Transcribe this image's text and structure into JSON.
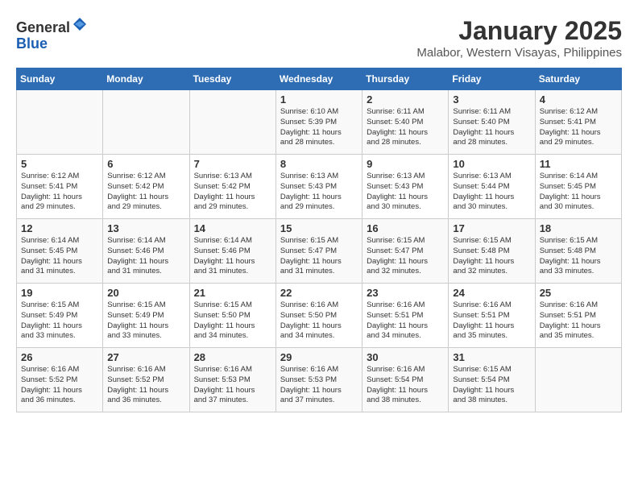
{
  "header": {
    "logo_line1": "General",
    "logo_line2": "Blue",
    "title": "January 2025",
    "subtitle": "Malabor, Western Visayas, Philippines"
  },
  "days_of_week": [
    "Sunday",
    "Monday",
    "Tuesday",
    "Wednesday",
    "Thursday",
    "Friday",
    "Saturday"
  ],
  "weeks": [
    [
      {
        "day": "",
        "info": ""
      },
      {
        "day": "",
        "info": ""
      },
      {
        "day": "",
        "info": ""
      },
      {
        "day": "1",
        "info": "Sunrise: 6:10 AM\nSunset: 5:39 PM\nDaylight: 11 hours\nand 28 minutes."
      },
      {
        "day": "2",
        "info": "Sunrise: 6:11 AM\nSunset: 5:40 PM\nDaylight: 11 hours\nand 28 minutes."
      },
      {
        "day": "3",
        "info": "Sunrise: 6:11 AM\nSunset: 5:40 PM\nDaylight: 11 hours\nand 28 minutes."
      },
      {
        "day": "4",
        "info": "Sunrise: 6:12 AM\nSunset: 5:41 PM\nDaylight: 11 hours\nand 29 minutes."
      }
    ],
    [
      {
        "day": "5",
        "info": "Sunrise: 6:12 AM\nSunset: 5:41 PM\nDaylight: 11 hours\nand 29 minutes."
      },
      {
        "day": "6",
        "info": "Sunrise: 6:12 AM\nSunset: 5:42 PM\nDaylight: 11 hours\nand 29 minutes."
      },
      {
        "day": "7",
        "info": "Sunrise: 6:13 AM\nSunset: 5:42 PM\nDaylight: 11 hours\nand 29 minutes."
      },
      {
        "day": "8",
        "info": "Sunrise: 6:13 AM\nSunset: 5:43 PM\nDaylight: 11 hours\nand 29 minutes."
      },
      {
        "day": "9",
        "info": "Sunrise: 6:13 AM\nSunset: 5:43 PM\nDaylight: 11 hours\nand 30 minutes."
      },
      {
        "day": "10",
        "info": "Sunrise: 6:13 AM\nSunset: 5:44 PM\nDaylight: 11 hours\nand 30 minutes."
      },
      {
        "day": "11",
        "info": "Sunrise: 6:14 AM\nSunset: 5:45 PM\nDaylight: 11 hours\nand 30 minutes."
      }
    ],
    [
      {
        "day": "12",
        "info": "Sunrise: 6:14 AM\nSunset: 5:45 PM\nDaylight: 11 hours\nand 31 minutes."
      },
      {
        "day": "13",
        "info": "Sunrise: 6:14 AM\nSunset: 5:46 PM\nDaylight: 11 hours\nand 31 minutes."
      },
      {
        "day": "14",
        "info": "Sunrise: 6:14 AM\nSunset: 5:46 PM\nDaylight: 11 hours\nand 31 minutes."
      },
      {
        "day": "15",
        "info": "Sunrise: 6:15 AM\nSunset: 5:47 PM\nDaylight: 11 hours\nand 31 minutes."
      },
      {
        "day": "16",
        "info": "Sunrise: 6:15 AM\nSunset: 5:47 PM\nDaylight: 11 hours\nand 32 minutes."
      },
      {
        "day": "17",
        "info": "Sunrise: 6:15 AM\nSunset: 5:48 PM\nDaylight: 11 hours\nand 32 minutes."
      },
      {
        "day": "18",
        "info": "Sunrise: 6:15 AM\nSunset: 5:48 PM\nDaylight: 11 hours\nand 33 minutes."
      }
    ],
    [
      {
        "day": "19",
        "info": "Sunrise: 6:15 AM\nSunset: 5:49 PM\nDaylight: 11 hours\nand 33 minutes."
      },
      {
        "day": "20",
        "info": "Sunrise: 6:15 AM\nSunset: 5:49 PM\nDaylight: 11 hours\nand 33 minutes."
      },
      {
        "day": "21",
        "info": "Sunrise: 6:15 AM\nSunset: 5:50 PM\nDaylight: 11 hours\nand 34 minutes."
      },
      {
        "day": "22",
        "info": "Sunrise: 6:16 AM\nSunset: 5:50 PM\nDaylight: 11 hours\nand 34 minutes."
      },
      {
        "day": "23",
        "info": "Sunrise: 6:16 AM\nSunset: 5:51 PM\nDaylight: 11 hours\nand 34 minutes."
      },
      {
        "day": "24",
        "info": "Sunrise: 6:16 AM\nSunset: 5:51 PM\nDaylight: 11 hours\nand 35 minutes."
      },
      {
        "day": "25",
        "info": "Sunrise: 6:16 AM\nSunset: 5:51 PM\nDaylight: 11 hours\nand 35 minutes."
      }
    ],
    [
      {
        "day": "26",
        "info": "Sunrise: 6:16 AM\nSunset: 5:52 PM\nDaylight: 11 hours\nand 36 minutes."
      },
      {
        "day": "27",
        "info": "Sunrise: 6:16 AM\nSunset: 5:52 PM\nDaylight: 11 hours\nand 36 minutes."
      },
      {
        "day": "28",
        "info": "Sunrise: 6:16 AM\nSunset: 5:53 PM\nDaylight: 11 hours\nand 37 minutes."
      },
      {
        "day": "29",
        "info": "Sunrise: 6:16 AM\nSunset: 5:53 PM\nDaylight: 11 hours\nand 37 minutes."
      },
      {
        "day": "30",
        "info": "Sunrise: 6:16 AM\nSunset: 5:54 PM\nDaylight: 11 hours\nand 38 minutes."
      },
      {
        "day": "31",
        "info": "Sunrise: 6:15 AM\nSunset: 5:54 PM\nDaylight: 11 hours\nand 38 minutes."
      },
      {
        "day": "",
        "info": ""
      }
    ]
  ]
}
